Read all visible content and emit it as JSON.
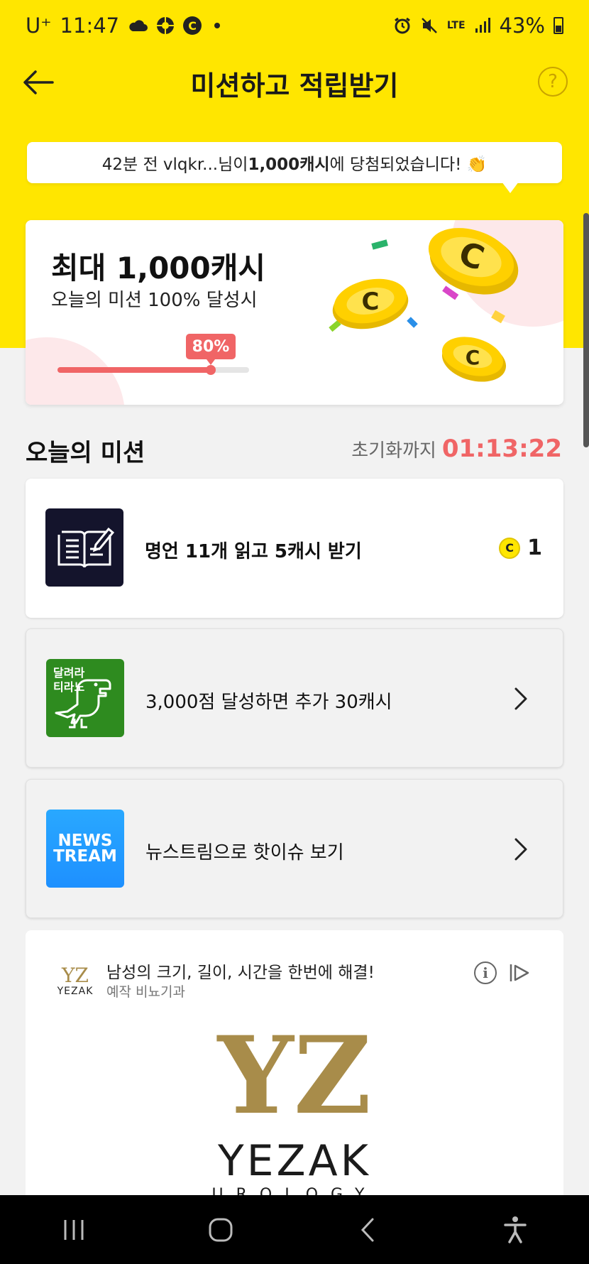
{
  "status_bar": {
    "carrier": "U⁺",
    "time": "11:47",
    "network": "LTE",
    "battery": "43%"
  },
  "header": {
    "title": "미션하고 적립받기",
    "help_symbol": "?"
  },
  "notice": {
    "prefix": "42분 전 vlqkr...님이 ",
    "amount": "1,000캐시",
    "suffix": "에 당첨되었습니다! 👏"
  },
  "reward": {
    "amount": "최대 1,000캐시",
    "subtitle": "오늘의 미션 100% 달성시",
    "progress_label": "80%",
    "progress_value": 0.8
  },
  "missions_header": {
    "title": "오늘의 미션",
    "reset_label": "초기화까지",
    "reset_time": "01:13:22"
  },
  "missions": [
    {
      "label": "명언 11개 읽고 5캐시 받기",
      "reward": "1",
      "coin_symbol": "C"
    },
    {
      "label": "3,000점 달성하면 추가 30캐시",
      "thumb_text": "달려라 티라노"
    },
    {
      "label": "뉴스트림으로 핫이슈 보기",
      "thumb_line1": "NEWS",
      "thumb_line2": "TREAM"
    }
  ],
  "ad": {
    "headline": "남성의 크기, 길이, 시간을 한번에 해결!",
    "sponsor": "예작 비뇨기과",
    "brand": "YEZAK",
    "brand_mark": "YZ",
    "brand_sub": "UROLOGY",
    "info_symbol": "i"
  },
  "colors": {
    "yellow": "#ffe600",
    "accent_red": "#f06566"
  }
}
